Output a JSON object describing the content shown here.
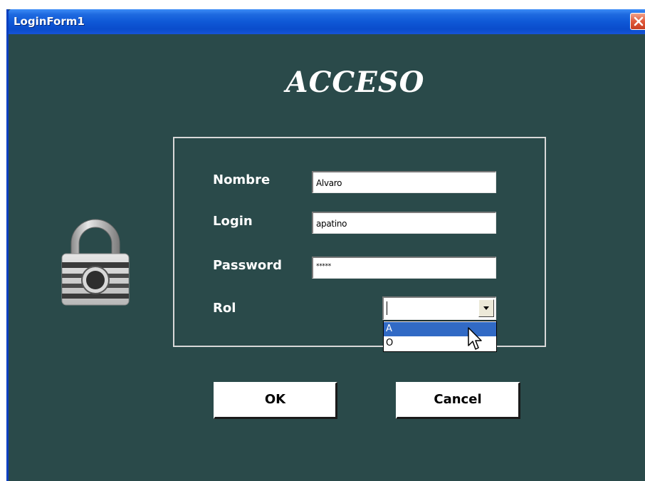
{
  "window": {
    "title": "LoginForm1"
  },
  "form": {
    "heading": "ACCESO",
    "fields": {
      "nombre": {
        "label": "Nombre",
        "value": "Alvaro"
      },
      "login": {
        "label": "Login",
        "value": "apatino"
      },
      "password": {
        "label": "Password",
        "value": "*****"
      },
      "rol": {
        "label": "Rol",
        "value": "",
        "options": [
          "A",
          "O"
        ],
        "highlighted": "A"
      }
    },
    "buttons": {
      "ok": "OK",
      "cancel": "Cancel"
    }
  },
  "icons": {
    "close": "close-icon",
    "lock": "padlock-icon",
    "dropdown": "chevron-down-icon",
    "cursor": "mouse-pointer-icon"
  },
  "colors": {
    "background": "#2a4a4a",
    "titlebar": "#0a4ccc",
    "selection": "#316ac5",
    "close": "#e0593b"
  }
}
